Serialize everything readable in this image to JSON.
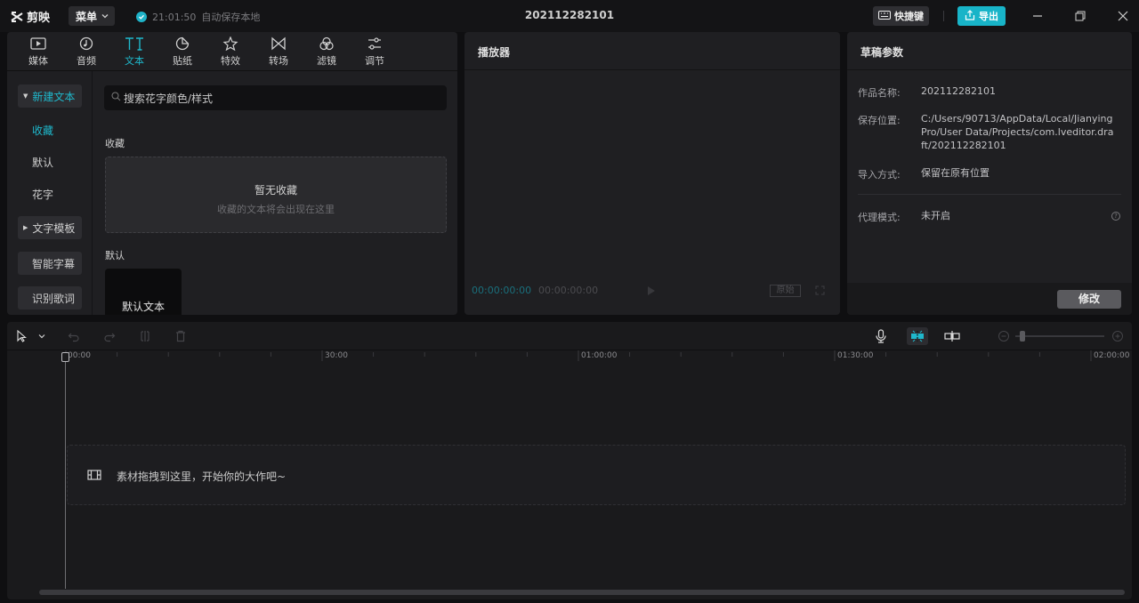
{
  "titlebar": {
    "app_name": "剪映",
    "menu_label": "菜单",
    "autosave_time": "21:01:50",
    "autosave_text": "自动保存本地",
    "project_title": "202112282101",
    "shortcut_label": "快捷键",
    "export_label": "导出",
    "icons": [
      "logo-icon",
      "chevron-down-icon",
      "check-icon",
      "keyboard-icon",
      "export-icon",
      "minimize-icon",
      "restore-icon",
      "close-icon"
    ]
  },
  "toolbar": {
    "tabs": [
      {
        "label": "媒体",
        "icon": "media-icon"
      },
      {
        "label": "音频",
        "icon": "audio-icon"
      },
      {
        "label": "文本",
        "icon": "text-icon",
        "active": true
      },
      {
        "label": "贴纸",
        "icon": "sticker-icon"
      },
      {
        "label": "特效",
        "icon": "effects-icon"
      },
      {
        "label": "转场",
        "icon": "transition-icon"
      },
      {
        "label": "滤镜",
        "icon": "filter-icon"
      },
      {
        "label": "调节",
        "icon": "adjust-icon"
      }
    ]
  },
  "sidebar": {
    "items": [
      {
        "label": "新建文本",
        "expanded": true
      },
      {
        "label": "收藏",
        "active": true
      },
      {
        "label": "默认"
      },
      {
        "label": "花字"
      },
      {
        "label": "文字模板",
        "expanded": false
      },
      {
        "label": "智能字幕"
      },
      {
        "label": "识别歌词"
      }
    ]
  },
  "library": {
    "search_placeholder": "搜索花字颜色/样式",
    "favorites_label": "收藏",
    "empty_title": "暂无收藏",
    "empty_subtitle": "收藏的文本将会出现在这里",
    "default_label": "默认",
    "default_card_text": "默认文本"
  },
  "player": {
    "title": "播放器",
    "current_time": "00:00:00:00",
    "total_time": "00:00:00:00",
    "ratio_label": "原始"
  },
  "draft": {
    "title": "草稿参数",
    "fields": [
      {
        "key": "作品名称:",
        "value": "202112282101"
      },
      {
        "key": "保存位置:",
        "value": "C:/Users/90713/AppData/Local/JianyingPro/User Data/Projects/com.lveditor.draft/202112282101"
      },
      {
        "key": "导入方式:",
        "value": "保留在原有位置"
      },
      {
        "key": "代理模式:",
        "value": "未开启"
      }
    ],
    "edit_label": "修改"
  },
  "timeline": {
    "ruler_labels": [
      "00:00",
      "30:00",
      "01:00:00",
      "01:30:00",
      "02:00:00"
    ],
    "drop_hint": "素材拖拽到这里，开始你的大作吧~",
    "zoom_level": 0.05
  },
  "colors": {
    "accent": "#1fb8cc",
    "panel": "#1f1f22",
    "background": "#0f0f11"
  }
}
